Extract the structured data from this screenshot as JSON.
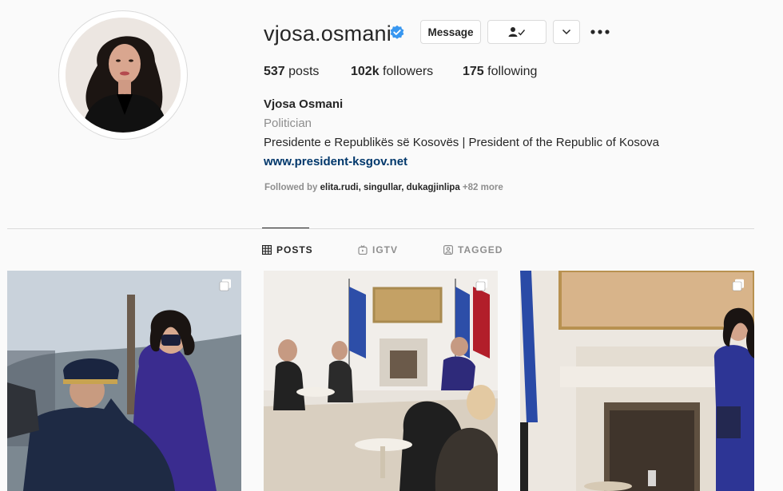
{
  "profile": {
    "username": "vjosa.osmani",
    "verified": true,
    "full_name": "Vjosa Osmani",
    "category": "Politician",
    "bio": "Presidente e Republikës së Kosovës | President of the Republic of Kosova",
    "website": "www.president-ksgov.net",
    "avatar_icon": "profile-photo"
  },
  "actions": {
    "message_label": "Message",
    "following_icon": "person-check-icon",
    "dropdown_icon": "chevron-down-icon",
    "more_icon": "more-horizontal-icon"
  },
  "stats": {
    "posts_count": "537",
    "posts_label": " posts",
    "followers_count": "102k",
    "followers_label": " followers",
    "following_count": "175",
    "following_label": " following"
  },
  "followed_by": {
    "prefix": "Followed by ",
    "names": "elita.rudi, singullar, dukagjinlipa",
    "more": " +82 more"
  },
  "tabs": [
    {
      "label": "POSTS",
      "icon": "grid-icon",
      "active": true
    },
    {
      "label": "IGTV",
      "icon": "igtv-icon",
      "active": false
    },
    {
      "label": "TAGGED",
      "icon": "tagged-icon",
      "active": false
    }
  ],
  "posts": [
    {
      "type": "multiple",
      "icon": "carousel-icon"
    },
    {
      "type": "multiple",
      "icon": "carousel-icon"
    },
    {
      "type": "multiple",
      "icon": "carousel-icon"
    }
  ],
  "colors": {
    "background": "#fafafa",
    "verified_blue": "#3897f0",
    "link": "#00376b",
    "secondary_text": "#8e8e8e",
    "border": "#dbdbdb"
  }
}
